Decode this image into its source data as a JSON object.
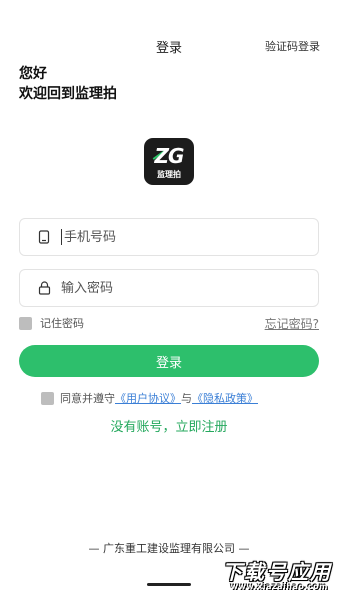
{
  "nav": {
    "title": "登录",
    "right_action": "验证码登录"
  },
  "greeting": {
    "line1": "您好",
    "line2": "欢迎回到监理拍"
  },
  "logo": {
    "mark": "ZG",
    "text": "监理拍",
    "accent": "#2ec76a"
  },
  "form": {
    "phone_placeholder": "手机号码",
    "phone_icon": "phone-icon",
    "password_placeholder": "输入密码",
    "password_icon": "lock-icon",
    "remember_label": "记住密码",
    "forgot_label": "忘记密码?",
    "login_label": "登录"
  },
  "agreement": {
    "prefix": "同意并遵守",
    "user_agreement": "《用户协议》",
    "connector": "与",
    "privacy_policy": "《隐私政策》"
  },
  "register_label": "没有账号，立即注册",
  "footer": {
    "company": "— 广东重工建设监理有限公司 —"
  },
  "watermark": {
    "main": "下载号应用",
    "sub": "www.xiazaihao.com"
  },
  "colors": {
    "primary": "#2dbf6c",
    "link": "#3b7fd6",
    "register": "#24a85d"
  }
}
